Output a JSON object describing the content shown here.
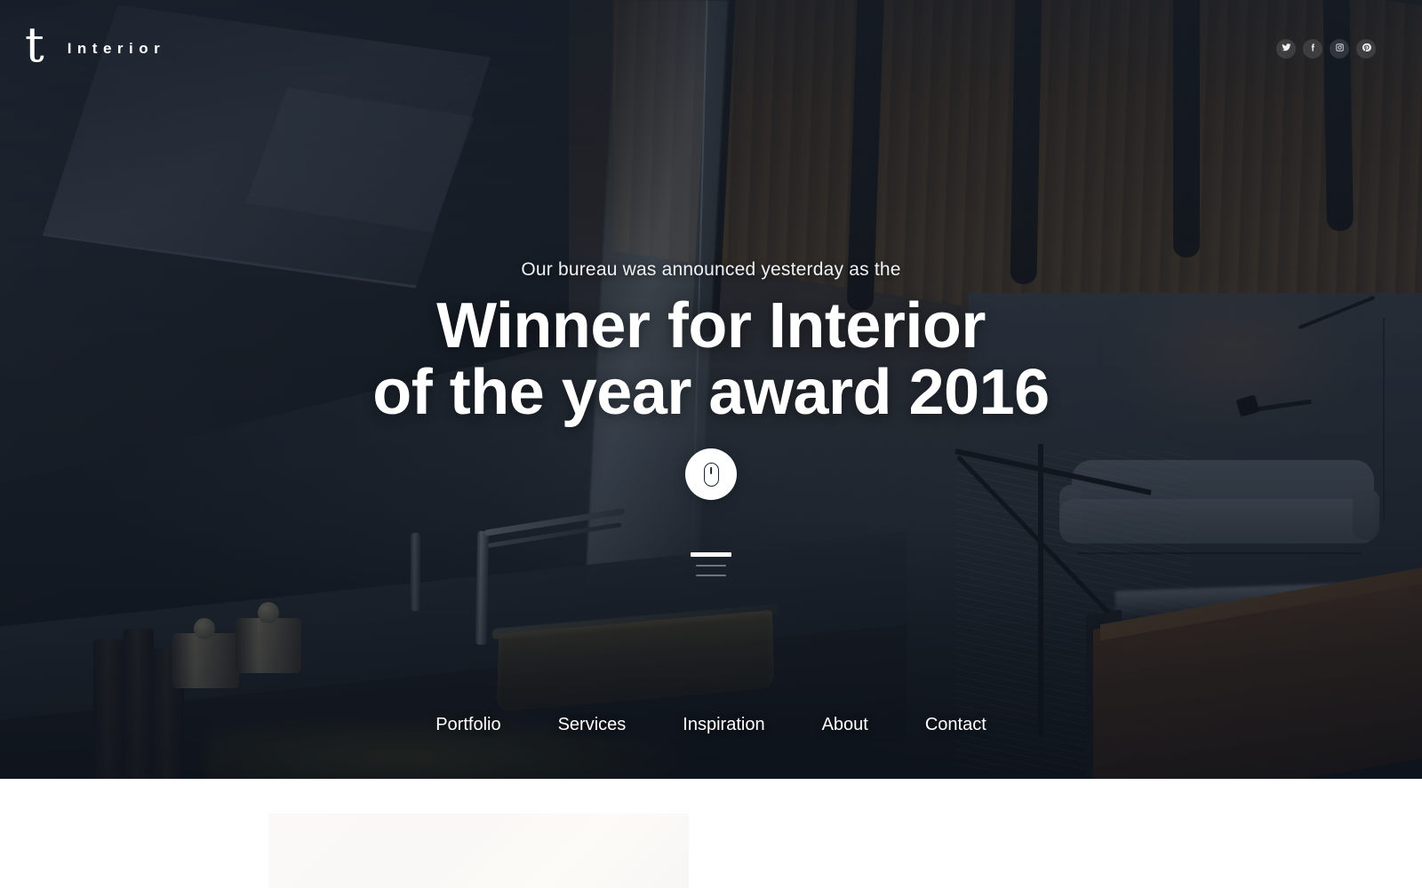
{
  "brand": {
    "logo_mark": "t",
    "name": "Interior"
  },
  "socials": [
    {
      "name": "twitter",
      "icon": "twitter-icon",
      "label": "Twitter"
    },
    {
      "name": "facebook",
      "icon": "facebook-icon",
      "label": "Facebook"
    },
    {
      "name": "instagram",
      "icon": "instagram-icon",
      "label": "Instagram"
    },
    {
      "name": "pinterest",
      "icon": "pinterest-icon",
      "label": "Pinterest"
    }
  ],
  "hero": {
    "eyebrow": "Our bureau was announced yesterday as the",
    "headline_line1": "Winner for Interior",
    "headline_line2": "of the year award 2016",
    "scroll_icon": "mouse-scroll-icon",
    "menu_icon": "hamburger-menu-icon"
  },
  "nav": {
    "items": [
      {
        "label": "Portfolio"
      },
      {
        "label": "Services"
      },
      {
        "label": "Inspiration"
      },
      {
        "label": "About"
      },
      {
        "label": "Contact"
      }
    ]
  },
  "colors": {
    "hero_overlay": "#141b26",
    "text_on_hero": "#ffffff",
    "page_background": "#ffffff",
    "social_bubble": "rgba(255,255,255,0.12)"
  }
}
